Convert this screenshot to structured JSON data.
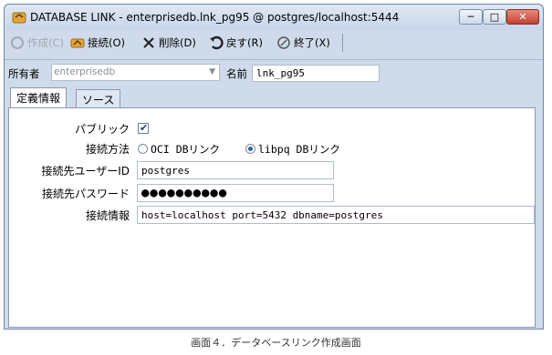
{
  "window": {
    "title": "DATABASE LINK - enterprisedb.lnk_pg95 @ postgres/localhost:5444",
    "controls": {
      "minimize": "─",
      "maximize": "□",
      "close": "✕"
    }
  },
  "toolbar": {
    "create_label": "作成(C)",
    "connect_label": "接続(O)",
    "delete_label": "削除(D)",
    "revert_label": "戻す(R)",
    "exit_label": "終了(X)"
  },
  "owner": {
    "label": "所有者",
    "value": "enterprisedb",
    "name_label": "名前",
    "name_value": "lnk_pg95"
  },
  "tabs": [
    "定義情報",
    "ソース"
  ],
  "form": {
    "public_label": "パブリック",
    "public_checked": true,
    "method_label": "接続方法",
    "method_options": [
      "OCI DBリンク",
      "libpq DBリンク"
    ],
    "method_selected": "libpq DBリンク",
    "user_label": "接続先ユーザーID",
    "user_value": "postgres",
    "password_label": "接続先パスワード",
    "password_value": "●●●●●●●●●●",
    "info_label": "接続情報",
    "info_value": "host=localhost port=5432 dbname=postgres"
  },
  "caption": "画面４．データベースリンク作成画面",
  "colors": {
    "window_bg": "#cfdbea",
    "close_btn": "#c3402e"
  },
  "icons": [
    "database-link-icon",
    "create-icon",
    "connect-icon",
    "delete-icon",
    "revert-icon",
    "exit-icon"
  ]
}
